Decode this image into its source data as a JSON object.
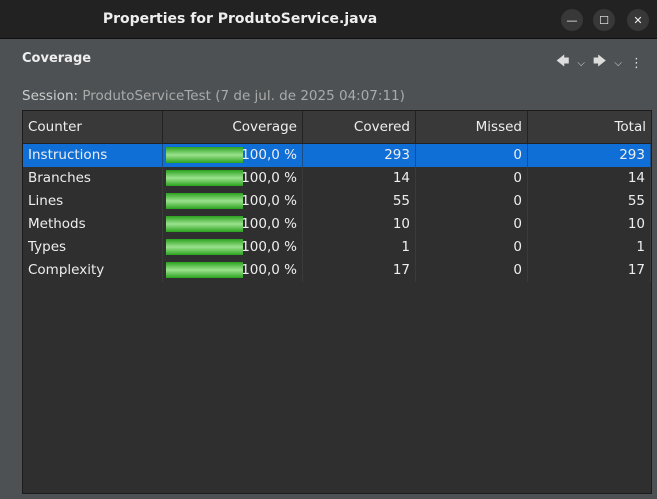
{
  "window": {
    "title": "Properties for ProdutoService.java"
  },
  "heading": "Coverage",
  "session": {
    "label": "Session:",
    "value": "ProdutoServiceTest (7 de jul. de 2025 04:07:11)"
  },
  "columns": [
    "Counter",
    "Coverage",
    "Covered",
    "Missed",
    "Total"
  ],
  "rows": [
    {
      "counter": "Instructions",
      "coverage": "100,0 %",
      "covered": "293",
      "missed": "0",
      "total": "293",
      "fraction": 1
    },
    {
      "counter": "Branches",
      "coverage": "100,0 %",
      "covered": "14",
      "missed": "0",
      "total": "14",
      "fraction": 1
    },
    {
      "counter": "Lines",
      "coverage": "100,0 %",
      "covered": "55",
      "missed": "0",
      "total": "55",
      "fraction": 1
    },
    {
      "counter": "Methods",
      "coverage": "100,0 %",
      "covered": "10",
      "missed": "0",
      "total": "10",
      "fraction": 1
    },
    {
      "counter": "Types",
      "coverage": "100,0 %",
      "covered": "1",
      "missed": "0",
      "total": "1",
      "fraction": 1
    },
    {
      "counter": "Complexity",
      "coverage": "100,0 %",
      "covered": "17",
      "missed": "0",
      "total": "17",
      "fraction": 1
    }
  ],
  "selected_row": 0
}
